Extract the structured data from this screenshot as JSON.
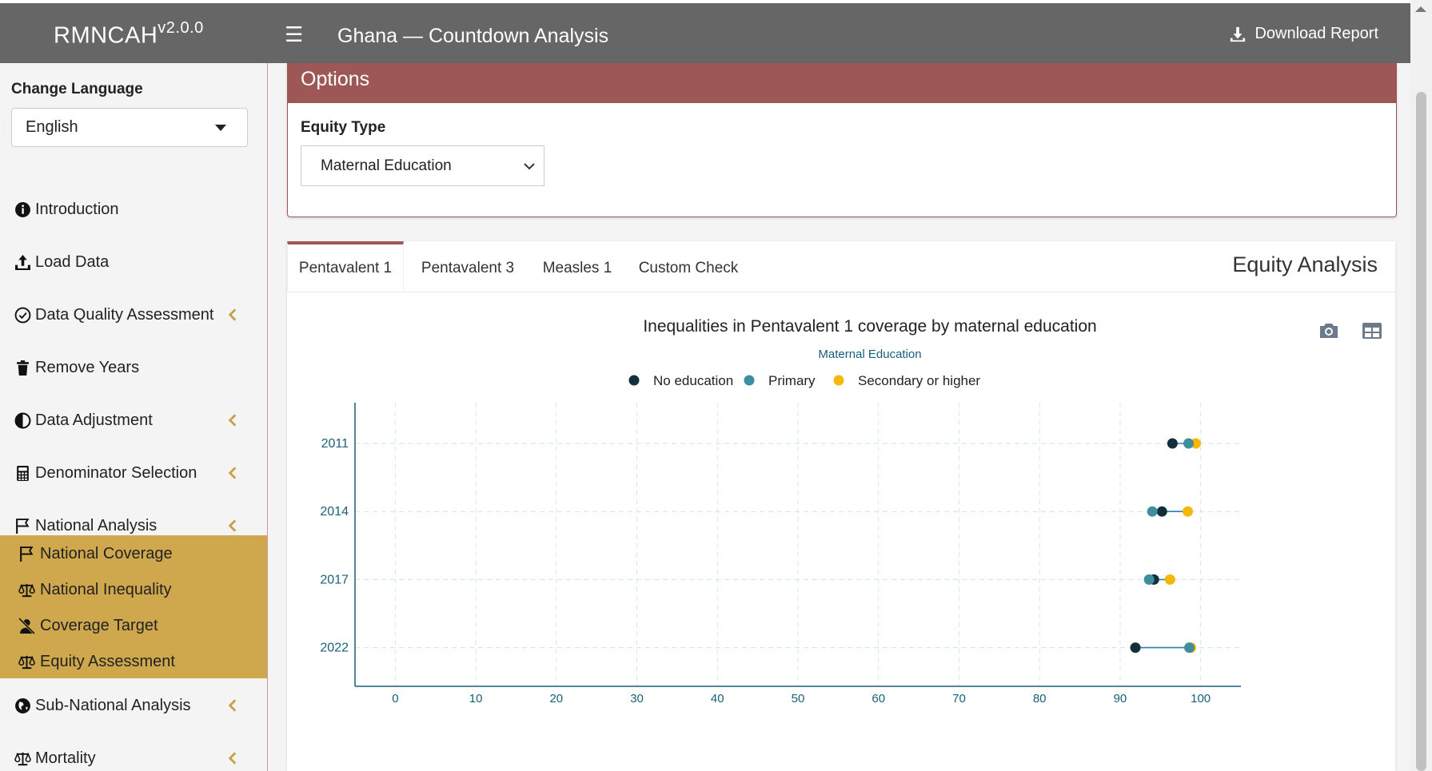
{
  "header": {
    "brand": "RMNCAH",
    "brand_version": "v2.0.0",
    "title": "Ghana — Countdown Analysis",
    "download_label": "Download Report"
  },
  "sidebar": {
    "language_label": "Change Language",
    "language_value": "English",
    "items": [
      {
        "label": "Introduction",
        "icon": "info-circle-icon",
        "chevron": false
      },
      {
        "label": "Load Data",
        "icon": "upload-icon",
        "chevron": false
      },
      {
        "label": "Data Quality Assessment",
        "icon": "check-circle-icon",
        "chevron": true
      },
      {
        "label": "Remove Years",
        "icon": "trash-icon",
        "chevron": false
      },
      {
        "label": "Data Adjustment",
        "icon": "adjust-icon",
        "chevron": true
      },
      {
        "label": "Denominator Selection",
        "icon": "calculator-icon",
        "chevron": true
      },
      {
        "label": "National Analysis",
        "icon": "flag-icon",
        "chevron": true
      },
      {
        "label": "Sub-National Analysis",
        "icon": "globe-icon",
        "chevron": true
      },
      {
        "label": "Mortality",
        "icon": "balance-scale-icon",
        "chevron": true
      }
    ],
    "subitems": [
      {
        "label": "National Coverage",
        "icon": "flag-icon"
      },
      {
        "label": "National Inequality",
        "icon": "balance-scale-icon"
      },
      {
        "label": "Coverage Target",
        "icon": "user-slash-icon"
      },
      {
        "label": "Equity Assessment",
        "icon": "balance-scale-icon"
      }
    ]
  },
  "options": {
    "title": "Options",
    "equity_label": "Equity Type",
    "equity_value": "Maternal Education"
  },
  "tabs": {
    "items": [
      "Pentavalent 1",
      "Pentavalent 3",
      "Measles 1",
      "Custom Check"
    ],
    "active": 0,
    "panel_title": "Equity Analysis"
  },
  "colors": {
    "header_bg": "#666666",
    "options_header": "#9e5757",
    "submenu_bg": "#cfa84e",
    "no_education": "#12303c",
    "primary": "#3f8ea0",
    "secondary": "#f5b800",
    "axis_text": "#1a5f7a"
  },
  "chart_data": {
    "type": "scatter",
    "title": "Inequalities in Pentavalent 1 coverage by maternal education",
    "legend_title": "Maternal Education",
    "legend_position": "top",
    "categories": [
      "2011",
      "2014",
      "2017",
      "2022"
    ],
    "x_ticks": [
      0,
      10,
      20,
      30,
      40,
      50,
      60,
      70,
      80,
      90,
      100
    ],
    "xlim": [
      -5,
      105
    ],
    "grid": true,
    "series": [
      {
        "name": "No education",
        "color": "#12303c",
        "values": [
          96.5,
          95.2,
          94.2,
          91.9
        ]
      },
      {
        "name": "Primary",
        "color": "#3f8ea0",
        "values": [
          98.5,
          94.0,
          93.6,
          98.6
        ]
      },
      {
        "name": "Secondary or higher",
        "color": "#f5b800",
        "values": [
          99.4,
          98.4,
          96.2,
          98.8
        ]
      }
    ]
  }
}
